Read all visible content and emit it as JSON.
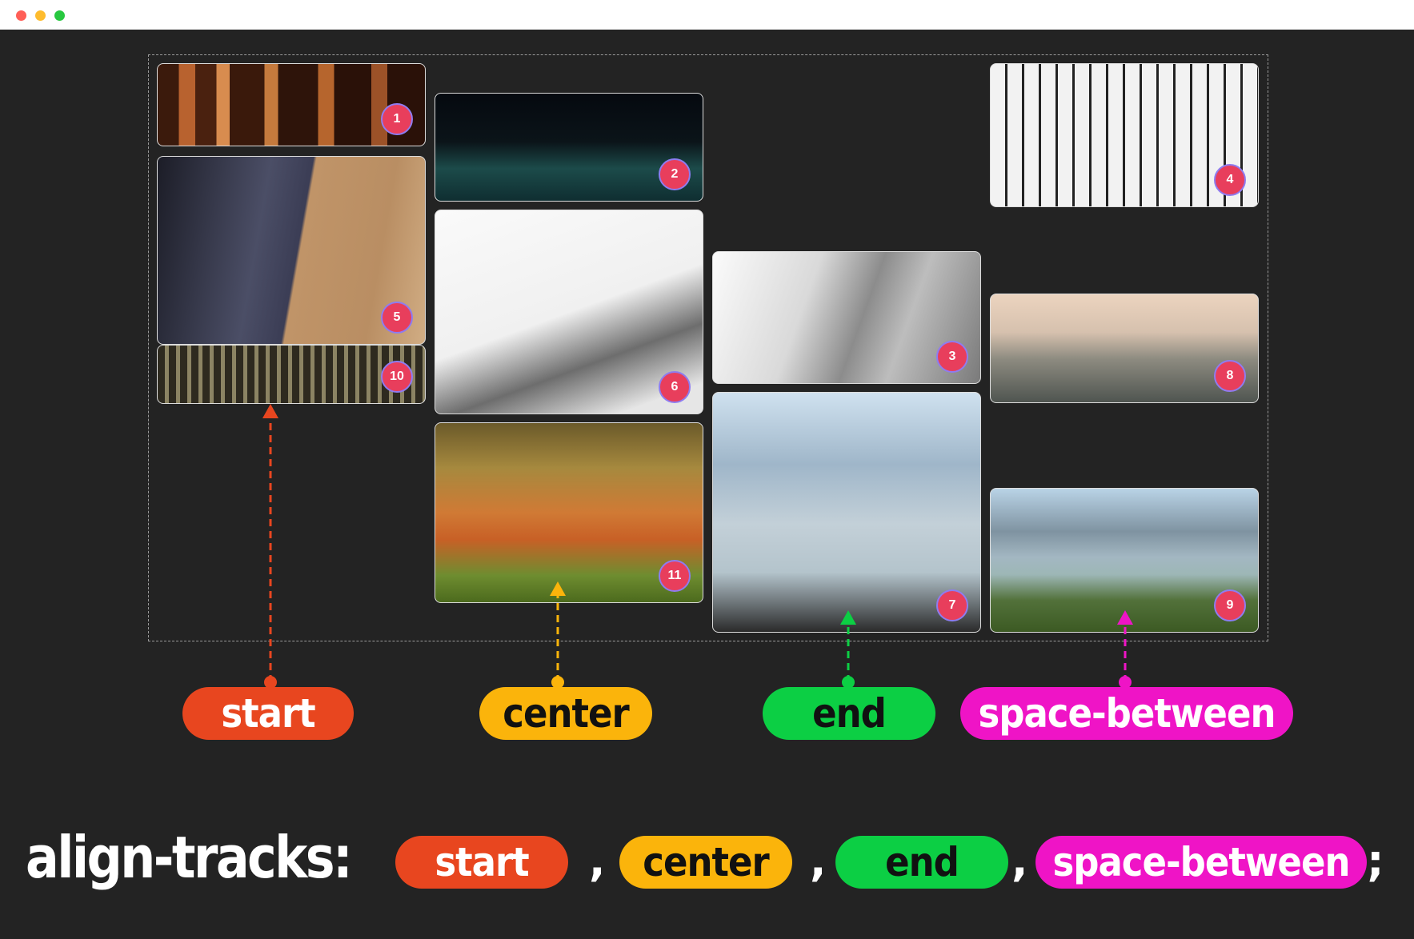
{
  "window": {
    "dots": [
      {
        "name": "close",
        "color": "#ff5f57"
      },
      {
        "name": "minimize",
        "color": "#febc2e"
      },
      {
        "name": "zoom",
        "color": "#28c840"
      }
    ]
  },
  "grid": {
    "tiles": [
      {
        "n": "1",
        "scene": "arches"
      },
      {
        "n": "2",
        "scene": "wave"
      },
      {
        "n": "3",
        "scene": "statue"
      },
      {
        "n": "4",
        "scene": "powerlines"
      },
      {
        "n": "5",
        "scene": "sand-dune"
      },
      {
        "n": "6",
        "scene": "foggy-mountain"
      },
      {
        "n": "7",
        "scene": "lake-pier"
      },
      {
        "n": "8",
        "scene": "valley"
      },
      {
        "n": "9",
        "scene": "lake-reeds"
      },
      {
        "n": "10",
        "scene": "forest-road"
      },
      {
        "n": "11",
        "scene": "tulips"
      }
    ]
  },
  "labels": [
    {
      "text": "start",
      "color": "#e8461f",
      "text_color": "#ffffff"
    },
    {
      "text": "center",
      "color": "#fbb40b",
      "text_color": "#111111"
    },
    {
      "text": "end",
      "color": "#0ccf44",
      "text_color": "#111111"
    },
    {
      "text": "space-between",
      "color": "#ef14c6",
      "text_color": "#ffffff"
    }
  ],
  "code": {
    "property": "align-tracks:",
    "values": [
      {
        "text": "start",
        "color": "#e8461f",
        "text_color": "#ffffff"
      },
      {
        "text": "center",
        "color": "#fbb40b",
        "text_color": "#111111"
      },
      {
        "text": "end",
        "color": "#0ccf44",
        "text_color": "#111111"
      },
      {
        "text": "space-between",
        "color": "#ef14c6",
        "text_color": "#ffffff"
      }
    ],
    "separator": ",",
    "terminator": ";"
  }
}
